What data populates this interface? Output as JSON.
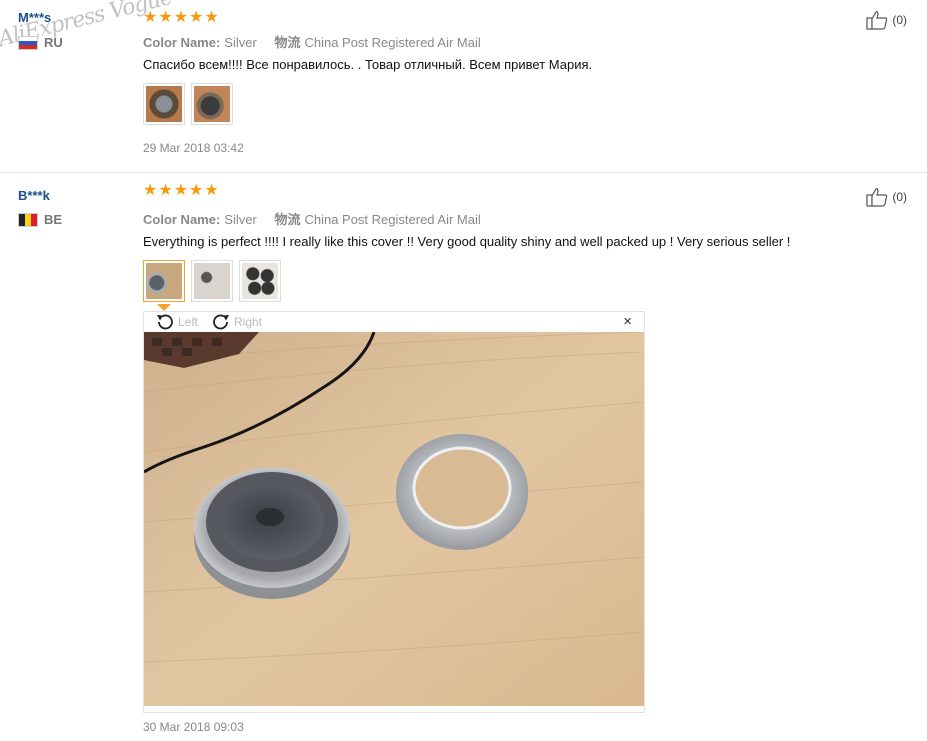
{
  "reviews": [
    {
      "username": "M***s",
      "country": "RU",
      "rating": 5,
      "color_label": "Color Name:",
      "color_value": "Silver",
      "shipping_label": "物流",
      "shipping_value": "China Post Registered Air Mail",
      "text": "Спасибо всем!!!! Все понравилось. . Товар отличный. Всем привет Мария.",
      "date": "29 Mar 2018 03:42",
      "useful": "(0)",
      "photos": 2
    },
    {
      "username": "B***k",
      "country": "BE",
      "rating": 5,
      "color_label": "Color Name:",
      "color_value": "Silver",
      "shipping_label": "物流",
      "shipping_value": "China Post Registered Air Mail",
      "text": "Everything is perfect !!!! I really like this cover !! Very good quality shiny and well packed up ! Very serious seller !",
      "date": "30 Mar 2018 09:03",
      "useful": "(0)",
      "photos": 3
    }
  ],
  "viewer": {
    "rotate_left": "Left",
    "rotate_right": "Right",
    "close": "×"
  },
  "watermark": "AliExpress Vogue",
  "colors": {
    "star": "#f79a10",
    "accent": "#f7a034",
    "username": "#1a4f8b"
  }
}
